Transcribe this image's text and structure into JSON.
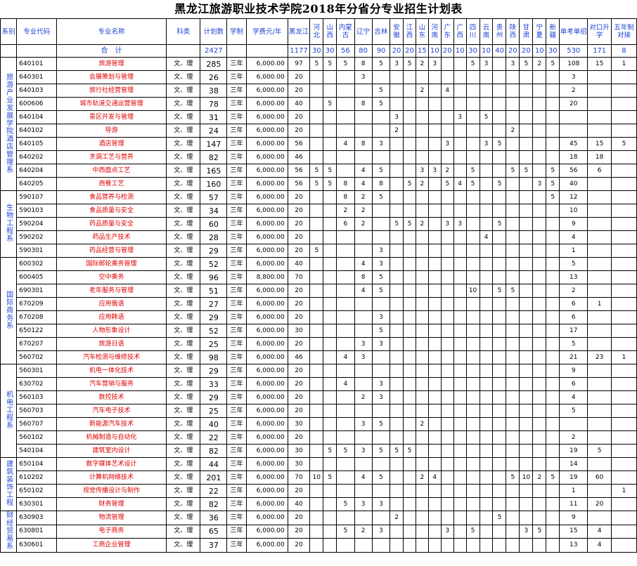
{
  "title": "黑龙江旅游职业技术学院2018年分省分专业招生计划表",
  "headers": [
    "系别",
    "专业代码",
    "专业名称",
    "科类",
    "计划数",
    "学制",
    "学费元/年",
    "黑龙江",
    "河北",
    "山西",
    "内蒙古",
    "辽宁",
    "吉林",
    "安徽",
    "江西",
    "山东",
    "河南",
    "广东",
    "广西",
    "四川",
    "云南",
    "贵州",
    "陕西",
    "甘肃",
    "宁夏",
    "新疆",
    "单考单招",
    "对口升学",
    "五年制对接"
  ],
  "total_row": [
    "合　计",
    "2427",
    "1177",
    "30",
    "30",
    "56",
    "80",
    "90",
    "20",
    "20",
    "15",
    "10",
    "20",
    "10",
    "30",
    "10",
    "40",
    "20",
    "20",
    "10",
    "30",
    "530",
    "171",
    "8"
  ],
  "departments": [
    {
      "name": "旅游产业发展学院",
      "rows": 10
    },
    {
      "name": "酒店管理系",
      "rows": 0
    },
    {
      "name": "生物工程系",
      "rows": 5
    },
    {
      "name": "国际商务系",
      "rows": 8
    },
    {
      "name": "机电工程系",
      "rows": 7
    },
    {
      "name": "建筑装饰工程",
      "rows": 4
    },
    {
      "name": "财经贸易系",
      "rows": 4
    }
  ],
  "rows": [
    [
      "640101",
      "旅游管理",
      "文、理",
      "285",
      "三年",
      "6,000.00",
      "97",
      "5",
      "5",
      "5",
      "8",
      "5",
      "3",
      "5",
      "2",
      "3",
      "",
      "",
      "5",
      "3",
      "",
      "3",
      "5",
      "2",
      "5",
      "108",
      "15",
      "1"
    ],
    [
      "640301",
      "会展策划与管理",
      "文、理",
      "26",
      "三年",
      "6,000.00",
      "20",
      "",
      "",
      "",
      "3",
      "",
      "",
      "",
      "",
      "",
      "",
      "",
      "",
      "",
      "",
      "",
      "",
      "",
      "",
      "3",
      "",
      ""
    ],
    [
      "640103",
      "旅行社经营管理",
      "文、理",
      "38",
      "三年",
      "6,000.00",
      "20",
      "",
      "",
      "",
      "",
      "5",
      "",
      "",
      "2",
      "",
      "4",
      "",
      "",
      "",
      "",
      "",
      "",
      "",
      "",
      "2",
      "",
      ""
    ],
    [
      "600606",
      "城市轨道交通运营管理",
      "文、理",
      "78",
      "三年",
      "6,000.00",
      "40",
      "",
      "5",
      "",
      "8",
      "5",
      "",
      "",
      "",
      "",
      "",
      "",
      "",
      "",
      "",
      "",
      "",
      "",
      "",
      "20",
      "",
      ""
    ],
    [
      "640104",
      "景区开发与管理",
      "文、理",
      "31",
      "三年",
      "6,000.00",
      "20",
      "",
      "",
      "",
      "",
      "",
      "3",
      "",
      "",
      "",
      "",
      "3",
      "",
      "5",
      "",
      "",
      "",
      "",
      "",
      "",
      "",
      ""
    ],
    [
      "640102",
      "导游",
      "文、理",
      "24",
      "三年",
      "6,000.00",
      "20",
      "",
      "",
      "",
      "",
      "",
      "2",
      "",
      "",
      "",
      "",
      "",
      "",
      "",
      "",
      "2",
      "",
      "",
      "",
      "",
      "",
      ""
    ],
    [
      "640105",
      "酒店管理",
      "文、理",
      "147",
      "三年",
      "6,000.00",
      "56",
      "",
      "",
      "4",
      "8",
      "3",
      "",
      "",
      "",
      "",
      "3",
      "",
      "",
      "3",
      "5",
      "",
      "",
      "",
      "",
      "45",
      "15",
      "5"
    ],
    [
      "640202",
      "烹调工艺与营养",
      "文、理",
      "82",
      "三年",
      "6,000.00",
      "46",
      "",
      "",
      "",
      "",
      "",
      "",
      "",
      "",
      "",
      "",
      "",
      "",
      "",
      "",
      "",
      "",
      "",
      "",
      "18",
      "18",
      ""
    ],
    [
      "640204",
      "中西面点工艺",
      "文、理",
      "165",
      "三年",
      "6,000.00",
      "56",
      "5",
      "5",
      "",
      "4",
      "5",
      "",
      "",
      "3",
      "3",
      "2",
      "",
      "5",
      "",
      "",
      "5",
      "5",
      "",
      "5",
      "56",
      "6",
      ""
    ],
    [
      "640205",
      "西餐工艺",
      "文、理",
      "160",
      "三年",
      "6,000.00",
      "56",
      "5",
      "5",
      "8",
      "4",
      "8",
      "",
      "5",
      "2",
      "",
      "5",
      "4",
      "5",
      "",
      "5",
      "",
      "",
      "3",
      "5",
      "40",
      "",
      ""
    ],
    [
      "590107",
      "食品营养与检测",
      "文、理",
      "57",
      "三年",
      "6,000.00",
      "20",
      "",
      "",
      "8",
      "2",
      "5",
      "",
      "",
      "",
      "",
      "",
      "",
      "",
      "",
      "",
      "",
      "",
      "",
      "5",
      "12",
      "",
      ""
    ],
    [
      "590103",
      "食品质量与安全",
      "文、理",
      "34",
      "三年",
      "6,000.00",
      "20",
      "",
      "",
      "2",
      "2",
      "",
      "",
      "",
      "",
      "",
      "",
      "",
      "",
      "",
      "",
      "",
      "",
      "",
      "",
      "10",
      "",
      ""
    ],
    [
      "590204",
      "药品质量与安全",
      "文、理",
      "60",
      "三年",
      "6,000.00",
      "20",
      "",
      "",
      "6",
      "2",
      "",
      "5",
      "5",
      "2",
      "",
      "3",
      "3",
      "",
      "",
      "5",
      "",
      "",
      "",
      "",
      "9",
      "",
      ""
    ],
    [
      "590202",
      "药品生产技术",
      "文、理",
      "28",
      "三年",
      "6,000.00",
      "20",
      "",
      "",
      "",
      "",
      "",
      "",
      "",
      "",
      "",
      "",
      "",
      "",
      "4",
      "",
      "",
      "",
      "",
      "",
      "4",
      "",
      ""
    ],
    [
      "590301",
      "药品经营与管理",
      "文、理",
      "29",
      "三年",
      "6,000.00",
      "20",
      "5",
      "",
      "",
      "",
      "3",
      "",
      "",
      "",
      "",
      "",
      "",
      "",
      "",
      "",
      "",
      "",
      "",
      "",
      "1",
      "",
      ""
    ],
    [
      "600302",
      "国际邮轮乘务管理",
      "文、理",
      "52",
      "三年",
      "6,000.00",
      "40",
      "",
      "",
      "",
      "4",
      "3",
      "",
      "",
      "",
      "",
      "",
      "",
      "",
      "",
      "",
      "",
      "",
      "",
      "",
      "5",
      "",
      ""
    ],
    [
      "600405",
      "空中乘务",
      "文、理",
      "96",
      "三年",
      "8,800.00",
      "70",
      "",
      "",
      "",
      "8",
      "5",
      "",
      "",
      "",
      "",
      "",
      "",
      "",
      "",
      "",
      "",
      "",
      "",
      "",
      "13",
      "",
      ""
    ],
    [
      "690301",
      "老年服务与管理",
      "文、理",
      "51",
      "三年",
      "6,000.00",
      "20",
      "",
      "",
      "",
      "4",
      "5",
      "",
      "",
      "",
      "",
      "",
      "",
      "10",
      "",
      "5",
      "5",
      "",
      "",
      "",
      "2",
      "",
      ""
    ],
    [
      "670209",
      "应用俄语",
      "文、理",
      "27",
      "三年",
      "6,000.00",
      "20",
      "",
      "",
      "",
      "",
      "",
      "",
      "",
      "",
      "",
      "",
      "",
      "",
      "",
      "",
      "",
      "",
      "",
      "",
      "6",
      "1",
      ""
    ],
    [
      "670208",
      "应用韩语",
      "文、理",
      "29",
      "三年",
      "6,000.00",
      "20",
      "",
      "",
      "",
      "",
      "3",
      "",
      "",
      "",
      "",
      "",
      "",
      "",
      "",
      "",
      "",
      "",
      "",
      "",
      "6",
      "",
      ""
    ],
    [
      "650122",
      "人物形象设计",
      "文、理",
      "52",
      "三年",
      "6,000.00",
      "30",
      "",
      "",
      "",
      "",
      "5",
      "",
      "",
      "",
      "",
      "",
      "",
      "",
      "",
      "",
      "",
      "",
      "",
      "",
      "17",
      "",
      ""
    ],
    [
      "670207",
      "旅游日语",
      "文、理",
      "25",
      "三年",
      "6,000.00",
      "20",
      "",
      "",
      "",
      "3",
      "3",
      "",
      "",
      "",
      "",
      "",
      "",
      "",
      "",
      "",
      "",
      "",
      "",
      "",
      "5",
      "",
      ""
    ],
    [
      "560702",
      "汽车检测与维修技术",
      "文、理",
      "98",
      "三年",
      "6,000.00",
      "46",
      "",
      "",
      "4",
      "3",
      "",
      "",
      "",
      "",
      "",
      "",
      "",
      "",
      "",
      "",
      "",
      "",
      "",
      "",
      "21",
      "23",
      "1"
    ],
    [
      "560301",
      "机电一体化技术",
      "文、理",
      "29",
      "三年",
      "6,000.00",
      "20",
      "",
      "",
      "",
      "",
      "",
      "",
      "",
      "",
      "",
      "",
      "",
      "",
      "",
      "",
      "",
      "",
      "",
      "",
      "9",
      "",
      ""
    ],
    [
      "630702",
      "汽车营销与服务",
      "文、理",
      "33",
      "三年",
      "6,000.00",
      "20",
      "",
      "",
      "4",
      "",
      "3",
      "",
      "",
      "",
      "",
      "",
      "",
      "",
      "",
      "",
      "",
      "",
      "",
      "",
      "6",
      "",
      ""
    ],
    [
      "560103",
      "数控技术",
      "文、理",
      "29",
      "三年",
      "6,000.00",
      "20",
      "",
      "",
      "",
      "2",
      "3",
      "",
      "",
      "",
      "",
      "",
      "",
      "",
      "",
      "",
      "",
      "",
      "",
      "",
      "4",
      "",
      ""
    ],
    [
      "560703",
      "汽车电子技术",
      "文、理",
      "25",
      "三年",
      "6,000.00",
      "20",
      "",
      "",
      "",
      "",
      "",
      "",
      "",
      "",
      "",
      "",
      "",
      "",
      "",
      "",
      "",
      "",
      "",
      "",
      "5",
      "",
      ""
    ],
    [
      "560707",
      "新能源汽车技术",
      "文、理",
      "40",
      "三年",
      "6,000.00",
      "30",
      "",
      "",
      "",
      "3",
      "5",
      "",
      "",
      "2",
      "",
      "",
      "",
      "",
      "",
      "",
      "",
      "",
      "",
      "",
      "",
      "",
      ""
    ],
    [
      "560102",
      "机械制造与自动化",
      "文、理",
      "22",
      "三年",
      "6,000.00",
      "20",
      "",
      "",
      "",
      "",
      "",
      "",
      "",
      "",
      "",
      "",
      "",
      "",
      "",
      "",
      "",
      "",
      "",
      "",
      "2",
      "",
      ""
    ],
    [
      "540104",
      "建筑室内设计",
      "文、理",
      "82",
      "三年",
      "6,000.00",
      "30",
      "",
      "5",
      "5",
      "3",
      "5",
      "5",
      "5",
      "",
      "",
      "",
      "",
      "",
      "",
      "",
      "",
      "",
      "",
      "",
      "19",
      "5",
      ""
    ],
    [
      "650104",
      "数字媒体艺术设计",
      "文、理",
      "44",
      "三年",
      "6,000.00",
      "30",
      "",
      "",
      "",
      "",
      "",
      "",
      "",
      "",
      "",
      "",
      "",
      "",
      "",
      "",
      "",
      "",
      "",
      "",
      "14",
      "",
      ""
    ],
    [
      "610202",
      "计算机网络技术",
      "文、理",
      "201",
      "三年",
      "6,000.00",
      "70",
      "10",
      "5",
      "",
      "4",
      "5",
      "",
      "",
      "2",
      "4",
      "",
      "",
      "",
      "",
      "",
      "5",
      "10",
      "2",
      "5",
      "19",
      "60",
      ""
    ],
    [
      "650102",
      "视觉传播设计与制作",
      "文、理",
      "22",
      "三年",
      "6,000.00",
      "20",
      "",
      "",
      "",
      "",
      "",
      "",
      "",
      "",
      "",
      "",
      "",
      "",
      "",
      "",
      "",
      "",
      "",
      "",
      "1",
      "",
      "1"
    ],
    [
      "630301",
      "财务管理",
      "文、理",
      "82",
      "三年",
      "6,000.00",
      "40",
      "",
      "",
      "5",
      "3",
      "3",
      "",
      "",
      "",
      "",
      "",
      "",
      "",
      "",
      "",
      "",
      "",
      "",
      "",
      "11",
      "20",
      ""
    ],
    [
      "630903",
      "物流管理",
      "文、理",
      "36",
      "三年",
      "6,000.00",
      "20",
      "",
      "",
      "",
      "",
      "",
      "2",
      "",
      "",
      "",
      "",
      "",
      "",
      "",
      "5",
      "",
      "",
      "",
      "",
      "9",
      "",
      ""
    ],
    [
      "630801",
      "电子商务",
      "文、理",
      "65",
      "三年",
      "6,000.00",
      "20",
      "",
      "",
      "5",
      "2",
      "3",
      "",
      "",
      "",
      "",
      "3",
      "",
      "5",
      "",
      "",
      "",
      "3",
      "5",
      "",
      "15",
      "4",
      ""
    ],
    [
      "630601",
      "工商企业管理",
      "文、理",
      "37",
      "三年",
      "6,000.00",
      "20",
      "",
      "",
      "",
      "",
      "",
      "",
      "",
      "",
      "",
      "",
      "",
      "",
      "",
      "",
      "",
      "",
      "",
      "",
      "13",
      "4",
      ""
    ]
  ]
}
